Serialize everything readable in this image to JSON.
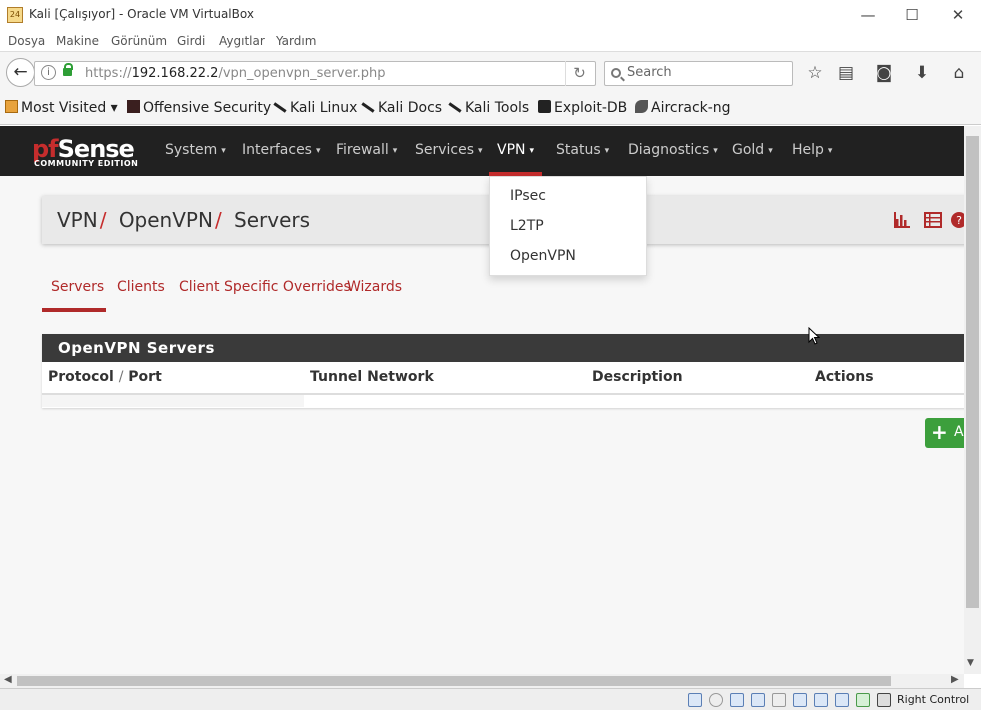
{
  "window": {
    "title": "Kali [Çalışıyor] - Oracle VM VirtualBox",
    "icon_label": "24",
    "controls": {
      "minimize": "—",
      "maximize": "☐",
      "close": "✕"
    }
  },
  "vb_menu": [
    "Dosya",
    "Makine",
    "Görünüm",
    "Girdi",
    "Aygıtlar",
    "Yardım"
  ],
  "browser": {
    "url_prefix": "https://",
    "url_host": "192.168.22.2",
    "url_path": "/vpn_openvpn_server.php",
    "search_placeholder": "Search",
    "toolbar_icons": [
      "star-icon",
      "reader-icon",
      "pocket-icon",
      "download-icon",
      "home-icon"
    ]
  },
  "bookmarks": [
    "Most Visited ▾",
    "Offensive Security",
    "Kali Linux",
    "Kali Docs",
    "Kali Tools",
    "Exploit-DB",
    "Aircrack-ng"
  ],
  "pfsense": {
    "logo_text_1": "pf",
    "logo_text_2": "Sense",
    "logo_sub": "COMMUNITY EDITION",
    "nav": [
      "System",
      "Interfaces",
      "Firewall",
      "Services",
      "VPN",
      "Status",
      "Diagnostics",
      "Gold",
      "Help"
    ],
    "active_nav": "VPN",
    "caret": "▾",
    "vpn_dropdown": [
      "IPsec",
      "L2TP",
      "OpenVPN"
    ],
    "breadcrumb": [
      "VPN",
      "OpenVPN",
      "Servers"
    ],
    "breadcrumb_sep": "/",
    "tabs": [
      "Servers",
      "Clients",
      "Client Specific Overrides",
      "Wizards"
    ],
    "active_tab": "Servers",
    "panel_title": "OpenVPN Servers",
    "columns": {
      "protocol": "Protocol",
      "sep": "/",
      "port": "Port",
      "tunnel": "Tunnel Network",
      "description": "Description",
      "actions": "Actions"
    },
    "add_button": {
      "icon": "+",
      "label": "Add"
    }
  },
  "statusbar": {
    "right_control": "Right Control"
  },
  "colors": {
    "accent": "#b02a2a",
    "nav_bg": "#212121",
    "add_green": "#3c9f3c"
  }
}
